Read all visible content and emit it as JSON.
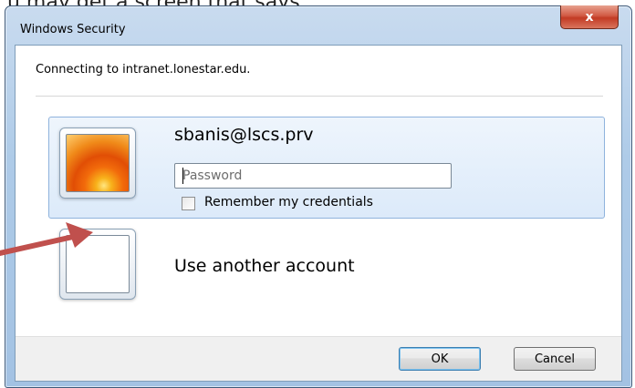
{
  "window": {
    "title": "Windows Security",
    "close_glyph": "x"
  },
  "message": "Connecting to intranet.lonestar.edu.",
  "account": {
    "username": "sbanis@lscs.prv",
    "password_placeholder": "Password",
    "remember_label": "Remember my credentials",
    "remember_checked": false
  },
  "other_account_label": "Use another account",
  "buttons": {
    "ok": "OK",
    "cancel": "Cancel"
  },
  "annotation": {
    "arrow_color": "#c0504d"
  },
  "colors": {
    "tile_border": "#8fb3dd",
    "close_button": "#c23b24"
  }
}
